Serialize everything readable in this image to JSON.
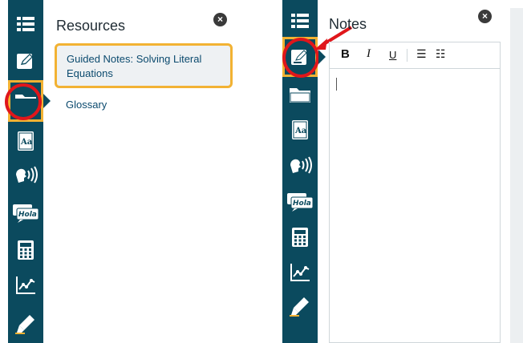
{
  "left_panel": {
    "title": "Resources",
    "close_symbol": "×",
    "items": [
      {
        "label": "Guided Notes: Solving Literal Equations",
        "selected": true
      },
      {
        "label": "Glossary",
        "selected": false
      }
    ],
    "active_tool": "folder-icon"
  },
  "right_panel": {
    "title": "Notes",
    "close_symbol": "×",
    "active_tool": "edit-icon",
    "formatting": {
      "bold": "B",
      "italic": "I",
      "underline": "U",
      "bullet_list": "☰",
      "numbered_list": "☷"
    }
  },
  "toolbar_icons": [
    "menu-icon",
    "edit-icon",
    "folder-icon",
    "glossary-icon",
    "text-to-speech-icon",
    "translate-icon",
    "calculator-icon",
    "graph-icon",
    "highlighter-icon"
  ],
  "colors": {
    "toolbar_bg": "#0b4a5e",
    "selection_outline": "#f2b233",
    "annotation_red": "#e0161b",
    "link": "#0b4a6e"
  }
}
